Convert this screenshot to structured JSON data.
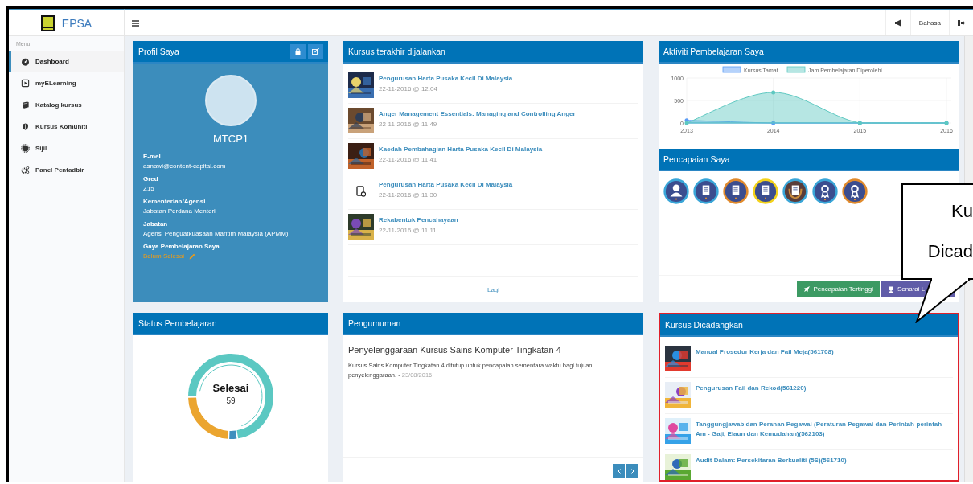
{
  "brand": {
    "name": "EPSA"
  },
  "topbar": {
    "language": "Bahasa"
  },
  "sidebar": {
    "heading": "Menu",
    "items": [
      {
        "label": "Dashboard",
        "selected": true
      },
      {
        "label": "myELearning",
        "selected": false
      },
      {
        "label": "Katalog kursus",
        "selected": false
      },
      {
        "label": "Kursus Komuniti",
        "selected": false
      },
      {
        "label": "Sijil",
        "selected": false
      },
      {
        "label": "Panel Pentadbir",
        "selected": false
      }
    ]
  },
  "profile": {
    "title": "Profil Saya",
    "name": "MTCP1",
    "fields": [
      {
        "label": "E-mel",
        "value": "asnawi@content-capital.com",
        "kind": "text"
      },
      {
        "label": "Gred",
        "value": "Z15",
        "kind": "text"
      },
      {
        "label": "Kementerian/Agensi",
        "value": "Jabatan Perdana Menteri",
        "kind": "text"
      },
      {
        "label": "Jabatan",
        "value": "Agensi Penguatkuasaan Maritim Malaysia (APMM)",
        "kind": "text"
      },
      {
        "label": "Gaya Pembelajaran Saya",
        "value": "Belum Selesai",
        "kind": "pending"
      }
    ]
  },
  "recent": {
    "title": "Kursus terakhir dijalankan",
    "more": "Lagi",
    "items": [
      {
        "title": "Pengurusan Harta Pusaka Kecil Di Malaysia",
        "date": "22-11-2016 @ 12:04",
        "kind": "picture"
      },
      {
        "title": "Anger Management Essentials: Managing and Controlling Anger",
        "date": "22-11-2016 @ 11:49",
        "kind": "picture"
      },
      {
        "title": "Kaedah Pembahagian Harta Pusaka Kecil Di Malaysia",
        "date": "22-11-2016 @ 11:41",
        "kind": "picture"
      },
      {
        "title": "Pengurusan Harta Pusaka Kecil Di Malaysia",
        "date": "22-11-2016 @ 11:30",
        "kind": "file"
      },
      {
        "title": "Rekabentuk Pencahayaan",
        "date": "22-11-2016 @ 11:11",
        "kind": "picture"
      }
    ]
  },
  "activity": {
    "title": "Aktiviti Pembelajaran Saya",
    "chart_data": {
      "type": "area",
      "grid": true,
      "legend": "top",
      "categories": [
        "2013",
        "2014",
        "2015",
        "2016"
      ],
      "ylim": [
        0,
        1000
      ],
      "yticks": [
        0,
        500,
        1000
      ],
      "series": [
        {
          "name": "Kursus Tamat",
          "color": "#5b9cf6",
          "values": [
            60,
            0,
            0,
            0
          ]
        },
        {
          "name": "Jam Pembelajaran Diperolehi",
          "color": "#5dc8c1",
          "values": [
            0,
            680,
            0,
            0
          ]
        }
      ]
    }
  },
  "achievements": {
    "title": "Pencapaian Saya",
    "badges": [
      {
        "kind": "person",
        "color": "#3aa6d8"
      },
      {
        "kind": "certificate",
        "color": "#3aa6d8"
      },
      {
        "kind": "certificate",
        "color": "#e08a2c"
      },
      {
        "kind": "certificate",
        "color": "#f3d21b"
      },
      {
        "kind": "wreath",
        "color": "#3aa6d8"
      },
      {
        "kind": "ribbon",
        "color": "#3aa6d8"
      },
      {
        "kind": "ribbon",
        "color": "#e08a2c"
      }
    ],
    "buttons": [
      {
        "label": "Pencapaian Tertinggi",
        "kind": "rocket"
      },
      {
        "label": "Senarai L",
        "kind": "trophy"
      }
    ]
  },
  "status": {
    "title": "Status Pembelajaran",
    "center_label": "Selesai",
    "center_value": "59"
  },
  "announcements": {
    "title": "Pengumuman",
    "heading": "Penyelenggaraan Kursus Sains Komputer Tingkatan 4",
    "body": "Kursus Sains Komputer Tingkatan 4 ditutup untuk pencapaian sementara waktu bagi tujuan penyelenggaraan. -",
    "date": "23/08/2016"
  },
  "recommended": {
    "title": "Kursus Dicadangkan",
    "items": [
      {
        "title": "Manual Prosedur Kerja dan Fail Meja(561708)",
        "kind": "picture"
      },
      {
        "title": "Pengurusan Fail dan Rekod(561220)",
        "kind": "picture"
      },
      {
        "title": "Tanggungjawab dan Peranan Pegawai (Peraturan Pegawai dan Perintah-perintah Am - Gaji, Elaun dan Kemudahan)(562103)",
        "kind": "picture"
      },
      {
        "title": "Audit Dalam: Persekitaran Berkualiti (5S)(561710)",
        "kind": "picture"
      }
    ]
  },
  "callout": {
    "lines": [
      "Ku",
      "Dicad"
    ]
  }
}
